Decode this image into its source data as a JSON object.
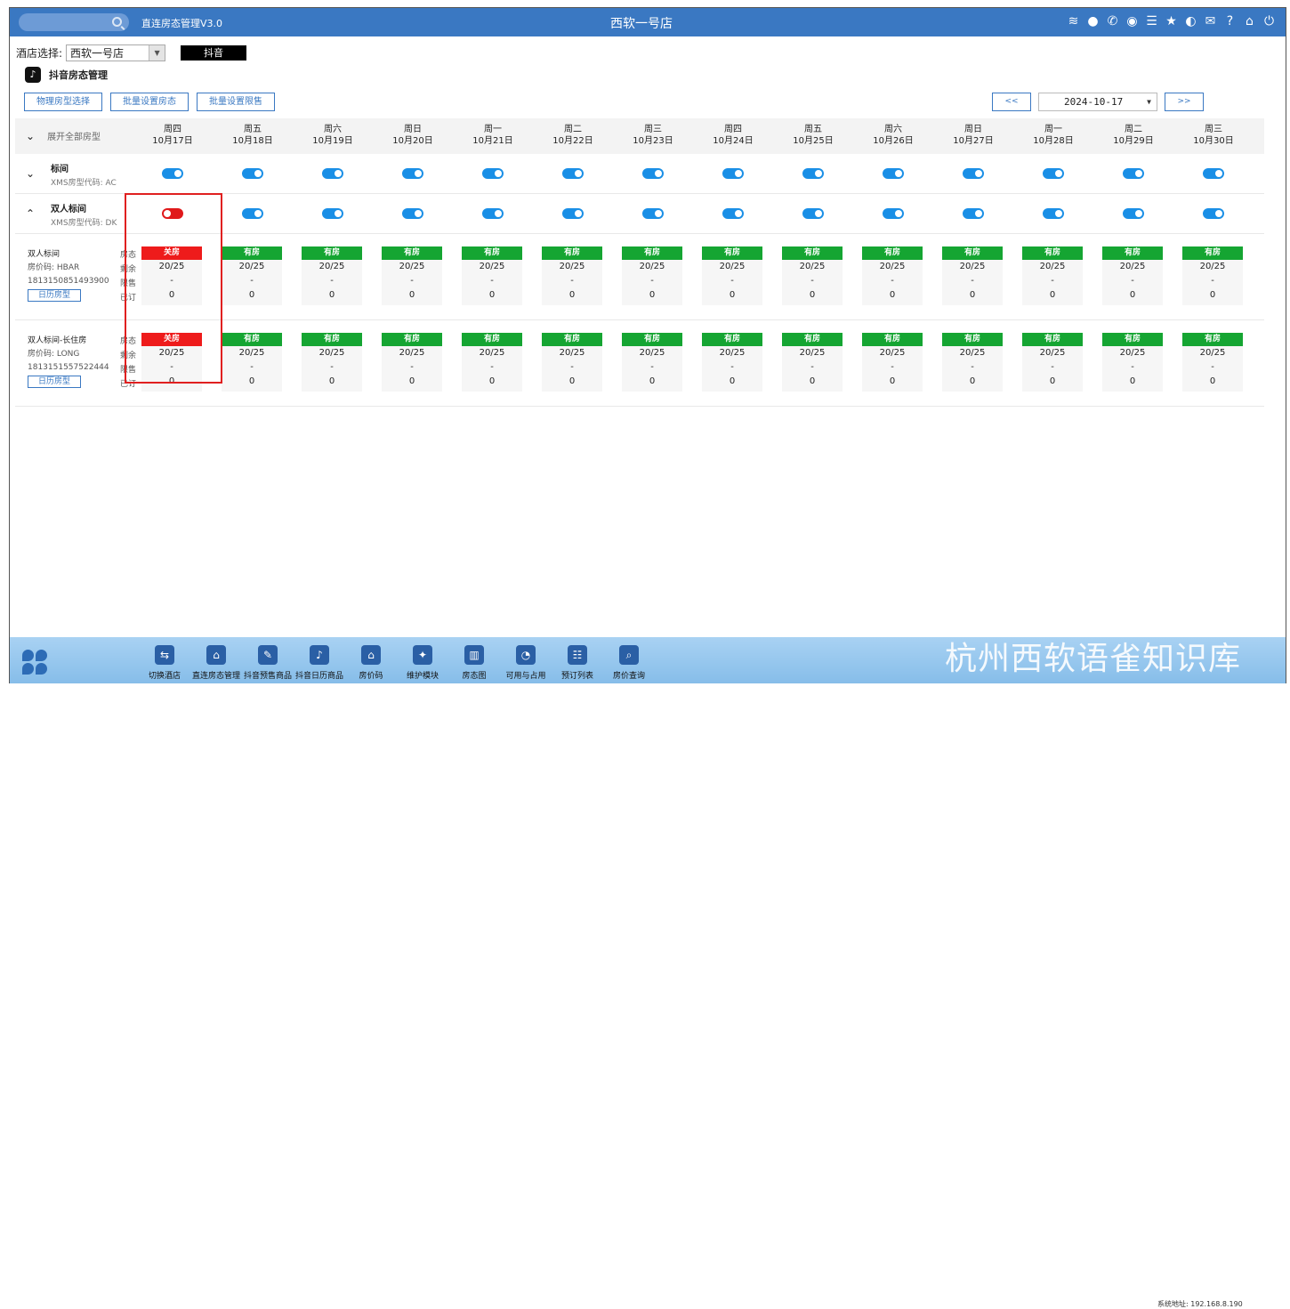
{
  "topbar": {
    "app_title": "直连房态管理V3.0",
    "store_title": "西软一号店",
    "icons": [
      "wifi-icon",
      "chat-icon",
      "phone-icon",
      "palette-icon",
      "menu-icon",
      "star-icon",
      "contrast-icon",
      "mail-icon",
      "help-icon",
      "home-icon",
      "power-icon"
    ]
  },
  "hotel": {
    "label": "酒店选择:",
    "selected": "西软一号店",
    "channel_button": "抖音"
  },
  "section": {
    "title": "抖音房态管理"
  },
  "toolbar": {
    "btn1": "物理房型选择",
    "btn2": "批量设置房态",
    "btn3": "批量设置限售"
  },
  "datenav": {
    "prev": "<<",
    "date": "2024-10-17",
    "next": ">>"
  },
  "grid": {
    "expand_label": "展开全部房型",
    "days": [
      {
        "week": "周四",
        "date": "10月17日"
      },
      {
        "week": "周五",
        "date": "10月18日"
      },
      {
        "week": "周六",
        "date": "10月19日"
      },
      {
        "week": "周日",
        "date": "10月20日"
      },
      {
        "week": "周一",
        "date": "10月21日"
      },
      {
        "week": "周二",
        "date": "10月22日"
      },
      {
        "week": "周三",
        "date": "10月23日"
      },
      {
        "week": "周四",
        "date": "10月24日"
      },
      {
        "week": "周五",
        "date": "10月25日"
      },
      {
        "week": "周六",
        "date": "10月26日"
      },
      {
        "week": "周日",
        "date": "10月27日"
      },
      {
        "week": "周一",
        "date": "10月28日"
      },
      {
        "week": "周二",
        "date": "10月29日"
      },
      {
        "week": "周三",
        "date": "10月30日"
      }
    ],
    "room_types": [
      {
        "name": "标间",
        "code": "XMS房型代码:  AC",
        "toggles": [
          true,
          true,
          true,
          true,
          true,
          true,
          true,
          true,
          true,
          true,
          true,
          true,
          true,
          true
        ]
      },
      {
        "name": "双人标间",
        "code": "XMS房型代码:  DK",
        "toggles": [
          false,
          true,
          true,
          true,
          true,
          true,
          true,
          true,
          true,
          true,
          true,
          true,
          true,
          true
        ]
      }
    ],
    "row_labels": [
      "房态",
      "剩余",
      "限售",
      "已订"
    ],
    "calendar_button": "日历房型",
    "products": [
      {
        "name": "双人标间",
        "price_code": "房价码:  HBAR",
        "id": "1813150851493900",
        "status": [
          "关房",
          "有房",
          "有房",
          "有房",
          "有房",
          "有房",
          "有房",
          "有房",
          "有房",
          "有房",
          "有房",
          "有房",
          "有房",
          "有房"
        ],
        "remain": "20/25",
        "limit": "-",
        "booked": "0"
      },
      {
        "name": "双人标间-长住房",
        "price_code": "房价码:  LONG",
        "id": "1813151557522444",
        "status": [
          "关房",
          "有房",
          "有房",
          "有房",
          "有房",
          "有房",
          "有房",
          "有房",
          "有房",
          "有房",
          "有房",
          "有房",
          "有房",
          "有房"
        ],
        "remain": "20/25",
        "limit": "-",
        "booked": "0"
      }
    ],
    "status_colors": {
      "open": "#15a532",
      "closed": "#ee1b1b"
    }
  },
  "footer": {
    "items": [
      {
        "label": "切换酒店",
        "icon": "switch-icon"
      },
      {
        "label": "直连房态管理",
        "icon": "house-gear-icon"
      },
      {
        "label": "抖音预售商品",
        "icon": "edit-doc-icon"
      },
      {
        "label": "抖音日历商品",
        "icon": "tiktok-icon"
      },
      {
        "label": "房价码",
        "icon": "home-icon"
      },
      {
        "label": "维护模块",
        "icon": "wrench-icon"
      },
      {
        "label": "房态图",
        "icon": "bank-icon"
      },
      {
        "label": "可用与占用",
        "icon": "pie-icon"
      },
      {
        "label": "预订列表",
        "icon": "list-doc-icon"
      },
      {
        "label": "房价查询",
        "icon": "search-doc-icon"
      }
    ],
    "watermark": "杭州西软语雀知识库",
    "sys_address": "系统地址: 192.168.8.190"
  }
}
